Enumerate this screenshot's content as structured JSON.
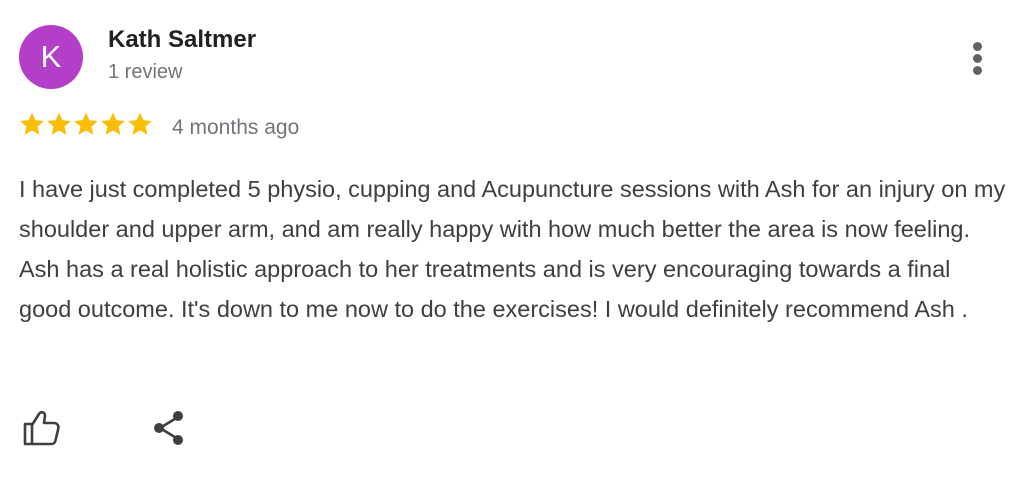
{
  "review": {
    "avatar_letter": "K",
    "avatar_color": "#b33fc9",
    "author_name": "Kath Saltmer",
    "review_count": "1 review",
    "rating": 5,
    "rating_max": 5,
    "star_color": "#fbbc04",
    "date": "4 months ago",
    "text": "I have just completed 5 physio, cupping and Acupuncture sessions with Ash for an injury on my shoulder and upper arm, and am really happy with how much better the area is now feeling. Ash has a real holistic approach to her treatments and is very encouraging towards a final good outcome. It's down to me now to do the exercises! I would definitely recommend Ash .",
    "icons": {
      "more": "more-vert-icon",
      "like": "thumbs-up-icon",
      "share": "share-icon"
    }
  }
}
